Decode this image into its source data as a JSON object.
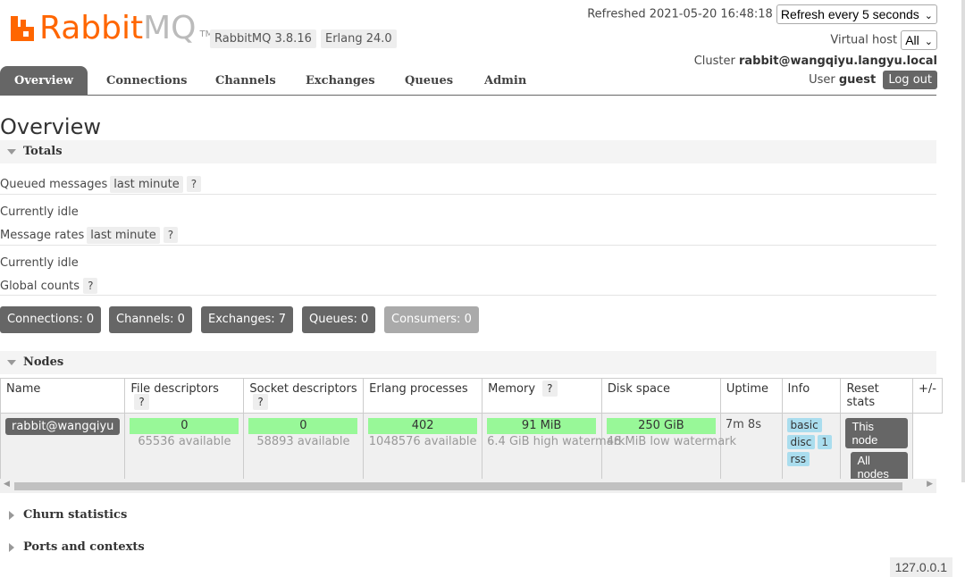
{
  "logo": {
    "part1": "Rabbit",
    "part2": "MQ",
    "tm": "TM"
  },
  "versions": {
    "rabbitmq": "RabbitMQ 3.8.16",
    "erlang": "Erlang 24.0"
  },
  "header": {
    "refreshed_label": "Refreshed 2021-05-20 16:48:18",
    "refresh_select": "Refresh every 5 seconds",
    "vhost_label": "Virtual host",
    "vhost_select": "All",
    "cluster_label": "Cluster",
    "cluster_value": "rabbit@wangqiyu.langyu.local",
    "user_label": "User",
    "user_value": "guest",
    "logout": "Log out"
  },
  "nav": {
    "tabs": [
      "Overview",
      "Connections",
      "Channels",
      "Exchanges",
      "Queues",
      "Admin"
    ],
    "active": "Overview"
  },
  "page_title": "Overview",
  "totals": {
    "heading": "Totals",
    "queued_label": "Queued messages",
    "queued_range": "last minute",
    "help": "?",
    "queued_status": "Currently idle",
    "rates_label": "Message rates",
    "rates_range": "last minute",
    "rates_status": "Currently idle",
    "global_label": "Global counts"
  },
  "counts": {
    "connections": "Connections: 0",
    "channels": "Channels: 0",
    "exchanges": "Exchanges: 7",
    "queues": "Queues: 0",
    "consumers": "Consumers: 0"
  },
  "nodes": {
    "heading": "Nodes",
    "columns": [
      "Name",
      "File descriptors",
      "Socket descriptors",
      "Erlang processes",
      "Memory",
      "Disk space",
      "Uptime",
      "Info",
      "Reset stats",
      "+/-"
    ],
    "row": {
      "name": "rabbit@wangqiyu",
      "fd_value": "0",
      "fd_sub": "65536 available",
      "sd_value": "0",
      "sd_sub": "58893 available",
      "ep_value": "402",
      "ep_sub": "1048576 available",
      "mem_value": "91 MiB",
      "mem_sub": "6.4 GiB high watermark",
      "disk_value": "250 GiB",
      "disk_sub": "48 MiB low watermark",
      "uptime": "7m 8s",
      "info_basic": "basic",
      "info_disc": "disc",
      "info_disc_count": "1",
      "info_rss": "rss",
      "reset_this": "This node",
      "reset_all": "All nodes"
    }
  },
  "collapsed_sections": [
    "Churn statistics",
    "Ports and contexts"
  ],
  "footer_ip": "127.0.0.1"
}
